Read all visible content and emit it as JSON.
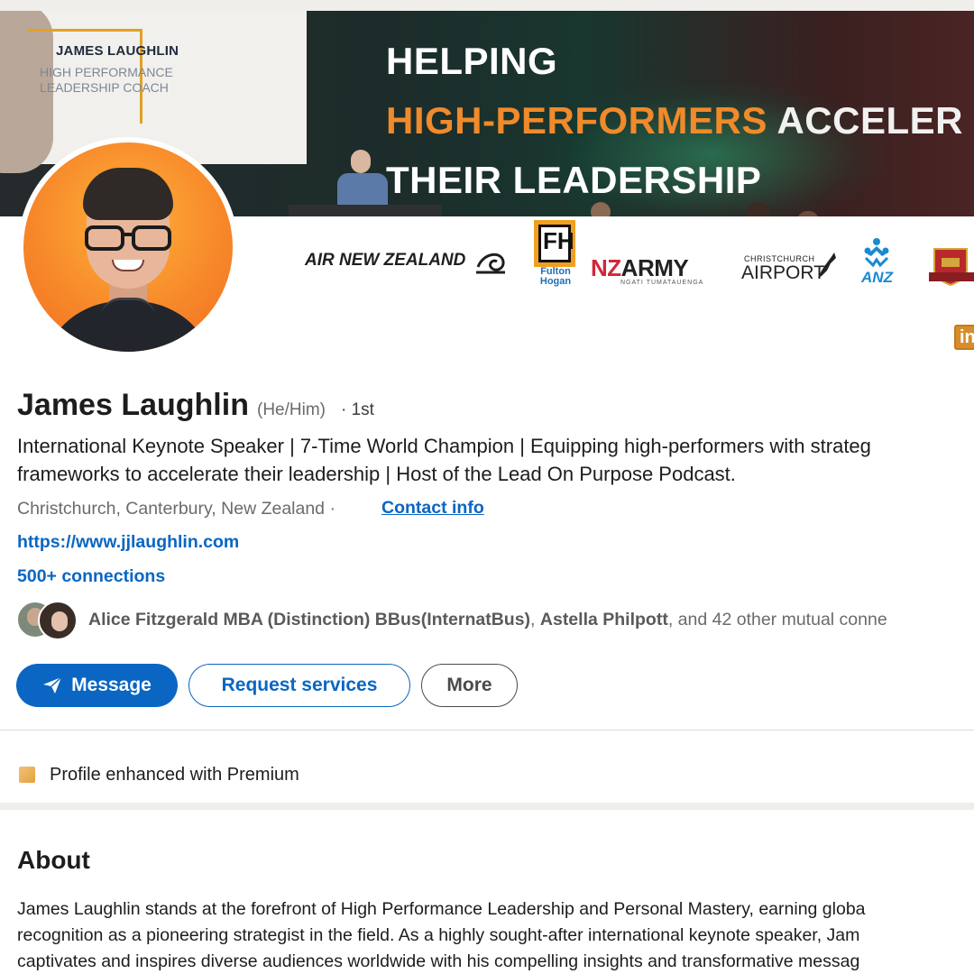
{
  "banner": {
    "screen_name": "JAMES LAUGHLIN",
    "screen_role_line1": "HIGH PERFORMANCE",
    "screen_role_line2": "LEADERSHIP COACH",
    "headline_line1": "HELPING",
    "headline_line2_highlight": "HIGH-PERFORMERS",
    "headline_line2_rest": " ACCELER",
    "headline_line3": "THEIR LEADERSHIP",
    "logos": {
      "air_nz": "AIR NEW ZEALAND",
      "fulton_hogan_line1": "Fulton",
      "fulton_hogan_line2": "Hogan",
      "fulton_hogan_mark": "FH",
      "nz_army_nz": "NZ",
      "nz_army_army": "ARMY",
      "nz_army_sub": "NGATI TUMATAUENGA",
      "chc_line1": "CHRISTCHURCH",
      "chc_line2": "AIRPORT",
      "anz": "ANZ"
    },
    "colors": {
      "highlight": "#f08a2a"
    }
  },
  "premium_badge": "in",
  "profile": {
    "name": "James Laughlin",
    "pronouns": "(He/Him)",
    "degree": "· 1st",
    "headline_line1": "International Keynote Speaker | 7-Time World Champion | Equipping high-performers with strateg",
    "headline_line2": "frameworks to accelerate their leadership | Host of the Lead On Purpose Podcast.",
    "location": "Christchurch, Canterbury, New Zealand ·",
    "contact_info": "Contact info",
    "website": "https://www.jjlaughlin.com",
    "connections": "500+ connections",
    "mutual_name1": "Alice Fitzgerald MBA (Distinction) BBus(InternatBus)",
    "mutual_sep": ", ",
    "mutual_name2": "Astella Philpott",
    "mutual_rest": ", and 42 other mutual conne"
  },
  "actions": {
    "message": "Message",
    "request_services": "Request services",
    "more": "More"
  },
  "premium_note": "Profile enhanced with Premium",
  "about": {
    "title": "About",
    "line1": "James Laughlin stands at the forefront of High Performance Leadership and Personal Mastery, earning globa",
    "line2": "recognition as a pioneering strategist in the field. As a highly sought-after international keynote speaker, Jam",
    "line3": "captivates and inspires diverse audiences worldwide with his compelling insights and transformative messag"
  },
  "colors": {
    "link": "#0a66c2",
    "text": "#1d1d1d",
    "muted": "#6b6b6b",
    "page_bg": "#efeeea"
  }
}
